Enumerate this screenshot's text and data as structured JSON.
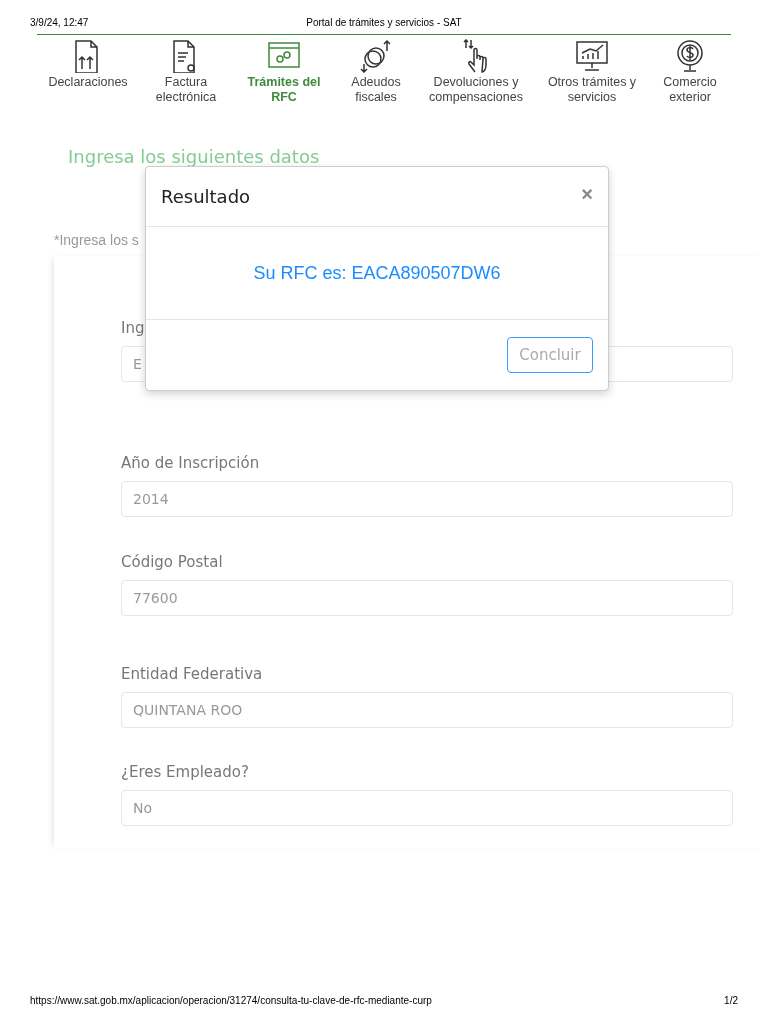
{
  "print_header": {
    "date": "3/9/24, 12:47",
    "title": "Portal de trámites y servicios - SAT"
  },
  "nav": [
    {
      "label": "Declaraciones",
      "kind": "document",
      "selected": false
    },
    {
      "label": "Factura electrónica",
      "kind": "invoice",
      "selected": false
    },
    {
      "label": "Trámites del RFC",
      "kind": "browser",
      "selected": true
    },
    {
      "label": "Adeudos fiscales",
      "kind": "coins",
      "selected": false
    },
    {
      "label": "Devoluciones y compensaciones",
      "kind": "hand",
      "selected": false
    },
    {
      "label": "Otros trámites y servicios",
      "kind": "chart",
      "selected": false
    },
    {
      "label": "Comercio exterior",
      "kind": "globe",
      "selected": false
    }
  ],
  "heading": "Ingresa los siguientes datos",
  "note": "*Ingresa los s",
  "form": {
    "fields": [
      {
        "label": "Ing",
        "value": "E"
      },
      {
        "label": "Año de Inscripción",
        "value": "2014"
      },
      {
        "label": "Código Postal",
        "value": "77600"
      },
      {
        "label": "Entidad Federativa",
        "value": "QUINTANA ROO"
      },
      {
        "label": "¿Eres Empleado?",
        "value": "No"
      }
    ]
  },
  "modal": {
    "title": "Resultado",
    "close": "×",
    "message": "Su RFC es: EACA890507DW6",
    "button": "Concluir"
  },
  "print_footer": {
    "url": "https://www.sat.gob.mx/aplicacion/operacion/31274/consulta-tu-clave-de-rfc-mediante-curp",
    "page": "1/2"
  }
}
